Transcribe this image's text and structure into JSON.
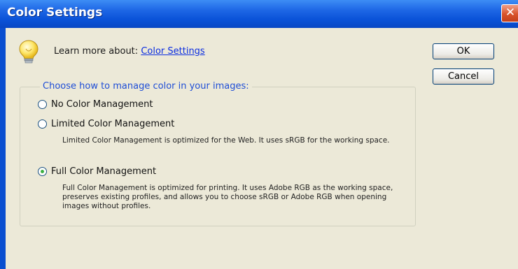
{
  "window": {
    "title": "Color Settings",
    "close_glyph": "✕"
  },
  "learn": {
    "prefix": "Learn more about:",
    "link": "Color Settings"
  },
  "buttons": {
    "ok": "OK",
    "cancel": "Cancel"
  },
  "group": {
    "legend": "Choose how to manage color in your images:",
    "options": [
      {
        "label": "No Color Management",
        "checked": false,
        "description": ""
      },
      {
        "label": "Limited Color Management",
        "checked": false,
        "description": "Limited Color Management is optimized for the Web. It uses sRGB for the working space."
      },
      {
        "label": "Full Color Management",
        "checked": true,
        "description": "Full Color Management is optimized for printing. It uses Adobe RGB as the working space, preserves existing profiles, and allows you to choose sRGB or Adobe RGB when opening images without profiles."
      }
    ]
  },
  "colors": {
    "titlebar": "#0a52d8",
    "dialog_bg": "#ece9d8",
    "link": "#0b2de0",
    "legend": "#1f4ed6"
  },
  "icons": {
    "tip": "lightbulb-icon"
  }
}
